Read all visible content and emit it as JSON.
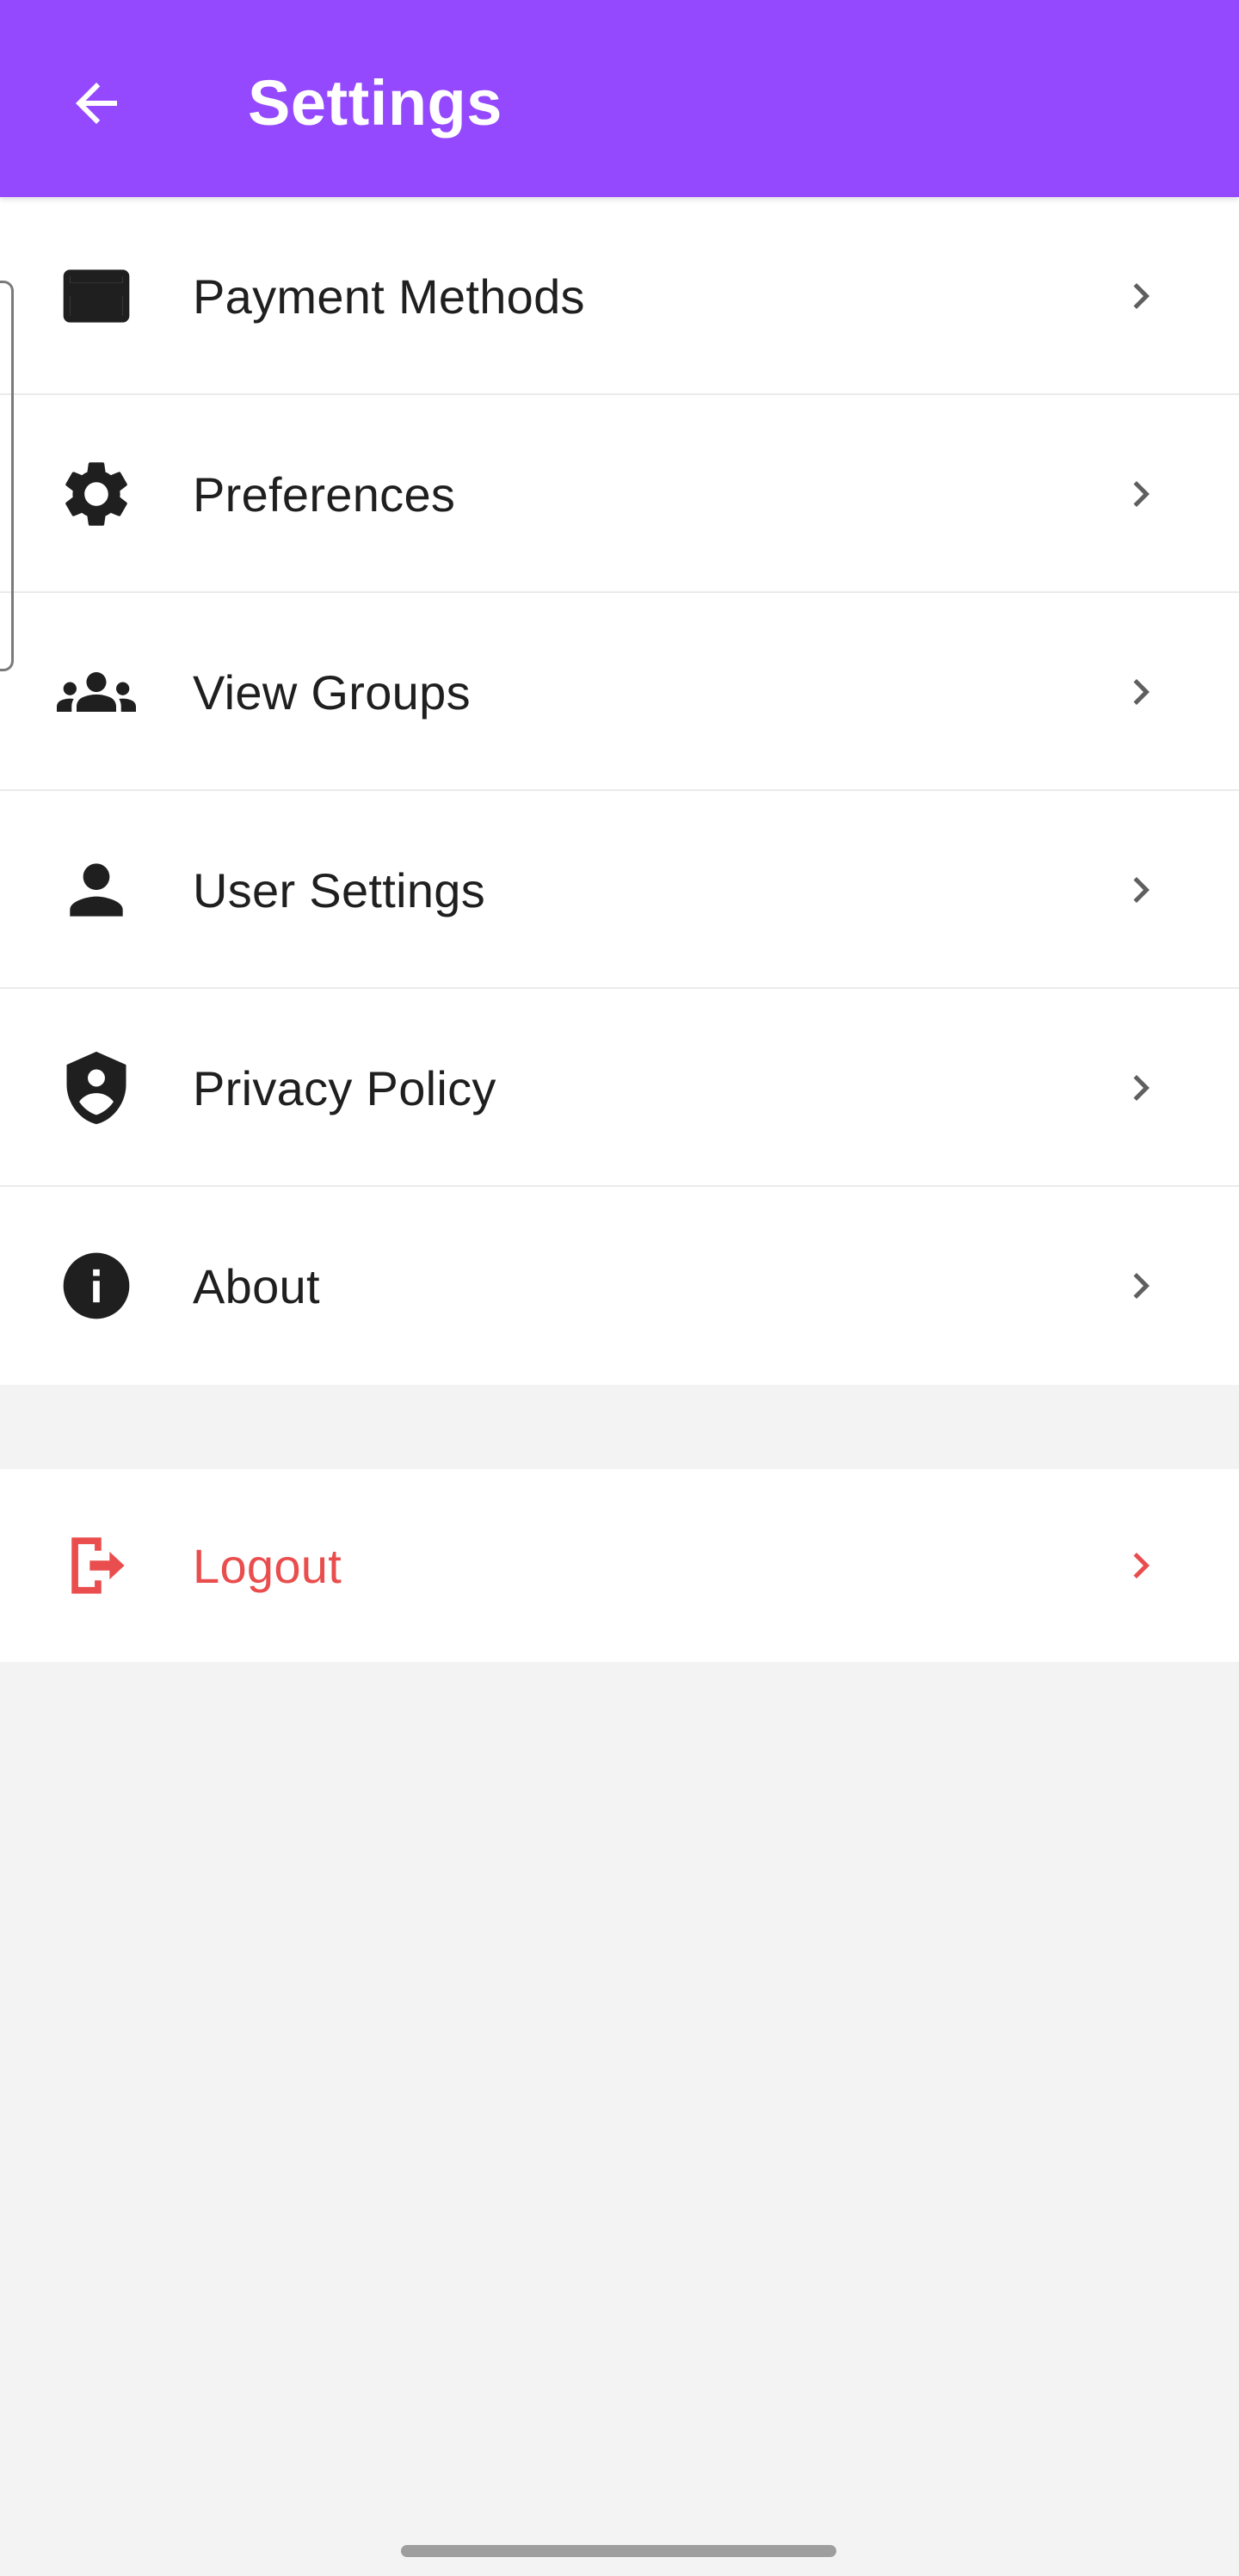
{
  "app_bar": {
    "title": "Settings",
    "back_icon": "arrow-back-icon",
    "background_color": "#9549fe"
  },
  "menu": {
    "items": [
      {
        "label": "Payment Methods",
        "icon": "credit-card-icon"
      },
      {
        "label": "Preferences",
        "icon": "gear-icon"
      },
      {
        "label": "View Groups",
        "icon": "groups-icon"
      },
      {
        "label": "User Settings",
        "icon": "person-icon"
      },
      {
        "label": "Privacy Policy",
        "icon": "shield-person-icon"
      },
      {
        "label": "About",
        "icon": "info-icon"
      }
    ]
  },
  "logout": {
    "label": "Logout",
    "icon": "logout-icon",
    "color": "#ea4d4d"
  }
}
